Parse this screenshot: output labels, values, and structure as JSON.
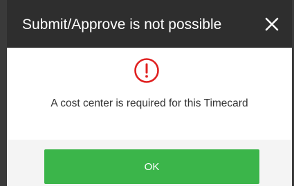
{
  "dialog": {
    "title": "Submit/Approve is not possible",
    "message": "A cost center is required for this Timecard",
    "ok_label": "OK",
    "close_icon": "close-icon",
    "alert_icon": "exclamation-circle-icon"
  },
  "colors": {
    "header_bg": "#2e2e2e",
    "alert_red": "#e02020",
    "ok_green": "#3bb54a",
    "footer_bg": "#f4f4f4"
  }
}
